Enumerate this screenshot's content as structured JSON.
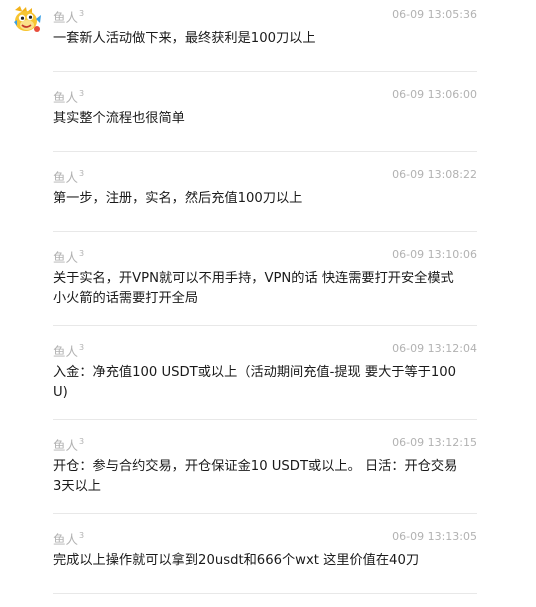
{
  "messages": [
    {
      "sender": "鱼人",
      "badge": "3",
      "time": "06-09 13:05:36",
      "text": "一套新人活动做下来，最终获利是100刀以上"
    },
    {
      "sender": "鱼人",
      "badge": "3",
      "time": "06-09 13:06:00",
      "text": "其实整个流程也很简单"
    },
    {
      "sender": "鱼人",
      "badge": "3",
      "time": "06-09 13:08:22",
      "text": "第一步，注册，实名，然后充值100刀以上"
    },
    {
      "sender": "鱼人",
      "badge": "3",
      "time": "06-09 13:10:06",
      "text": "关于实名，开VPN就可以不用手持，VPN的话 快连需要打开安全模式 小火箭的话需要打开全局"
    },
    {
      "sender": "鱼人",
      "badge": "3",
      "time": "06-09 13:12:04",
      "text": "入金：净充值100 USDT或以上（活动期间充值-提现 要大于等于100U)"
    },
    {
      "sender": "鱼人",
      "badge": "3",
      "time": "06-09 13:12:15",
      "text": "开仓：参与合约交易，开仓保证金10 USDT或以上。 日活：开仓交易3天以上"
    },
    {
      "sender": "鱼人",
      "badge": "3",
      "time": "06-09 13:13:05",
      "text": "完成以上操作就可以拿到20usdt和666个wxt   这里价值在40刀"
    },
    {
      "sender": "鱼人",
      "badge": "3",
      "time": "",
      "text": ""
    }
  ]
}
